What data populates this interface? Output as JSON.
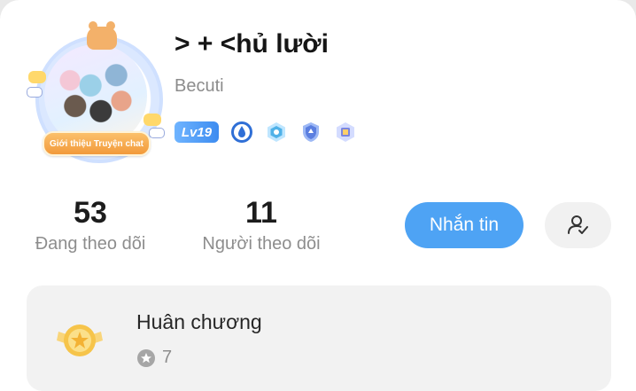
{
  "profile": {
    "display_name": "> + <hủ lười",
    "username": "Becuti",
    "avatar_banner": "Giới thiệu Truyện chat",
    "level_badge": "Lv19",
    "badge_icons": [
      "droplet-badge-icon",
      "hexagon-badge-icon",
      "shield-badge-icon",
      "book-badge-icon"
    ]
  },
  "stats": {
    "following_count": "53",
    "following_label": "Đang theo dõi",
    "followers_count": "11",
    "followers_label": "Người theo dõi"
  },
  "actions": {
    "message_label": "Nhắn tin",
    "follow_icon": "user-check-icon"
  },
  "medals": {
    "title": "Huân chương",
    "count": "7"
  },
  "colors": {
    "accent": "#4ea3f4",
    "level_badge": "#3d8cf0",
    "medal_gold": "#f6c44a"
  }
}
